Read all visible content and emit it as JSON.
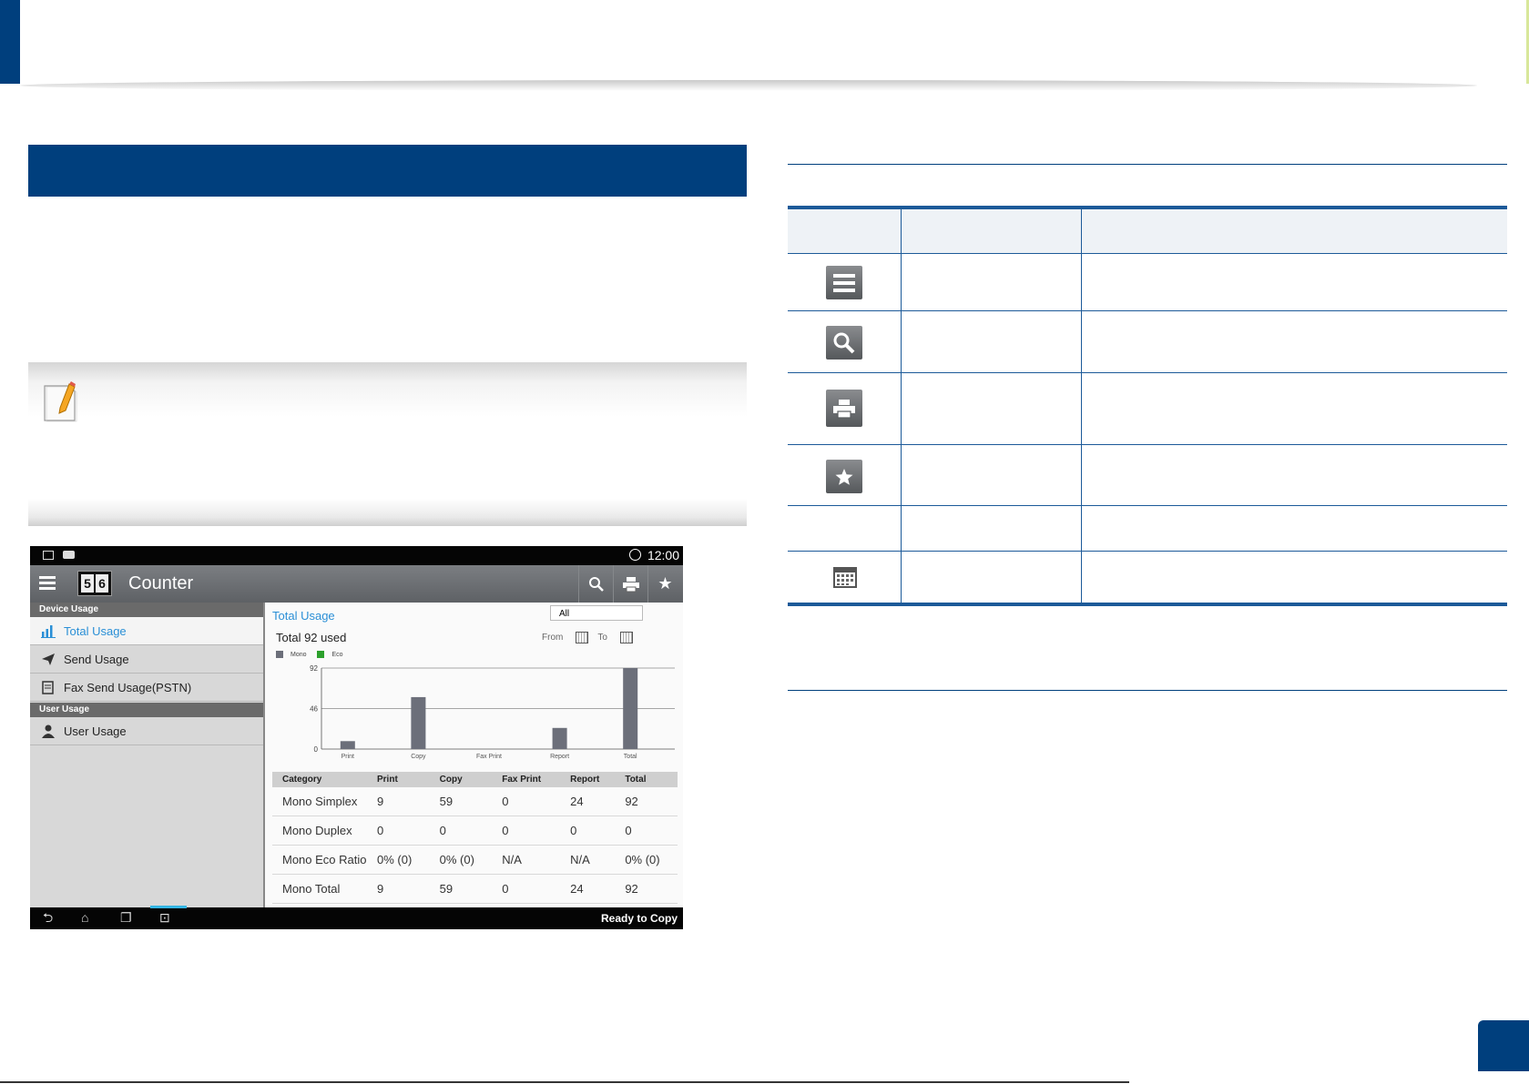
{
  "device": {
    "status_time": "12:00",
    "app_title": "Counter",
    "logo_digits": [
      "5",
      "6"
    ],
    "sidebar": {
      "section1": "Device Usage",
      "items1": [
        "Total Usage",
        "Send Usage",
        "Fax Send Usage(PSTN)"
      ],
      "section2": "User Usage",
      "items2": [
        "User Usage"
      ]
    },
    "content": {
      "heading": "Total Usage",
      "filter_value": "All",
      "total_text": "Total 92 used",
      "from_label": "From",
      "to_label": "To",
      "legend_mono": "Mono",
      "legend_eco": "Eco"
    },
    "table": {
      "headers": [
        "Category",
        "Print",
        "Copy",
        "Fax Print",
        "Report",
        "Total"
      ],
      "rows": [
        [
          "Mono Simplex",
          "9",
          "59",
          "0",
          "24",
          "92"
        ],
        [
          "Mono Duplex",
          "0",
          "0",
          "0",
          "0",
          "0"
        ],
        [
          "Mono Eco Ratio",
          "0% (0)",
          "0% (0)",
          "N/A",
          "N/A",
          "0% (0)"
        ],
        [
          "Mono Total",
          "9",
          "59",
          "0",
          "24",
          "92"
        ]
      ]
    },
    "status_message": "Ready to Copy"
  },
  "chart_data": {
    "type": "bar",
    "categories": [
      "Print",
      "Copy",
      "Fax Print",
      "Report",
      "Total"
    ],
    "series": [
      {
        "name": "Mono",
        "values": [
          9,
          59,
          0,
          24,
          92
        ]
      },
      {
        "name": "Eco",
        "values": [
          0,
          0,
          0,
          0,
          0
        ]
      }
    ],
    "yticks": [
      0,
      46,
      92
    ],
    "ylim": [
      0,
      92
    ],
    "grid": true,
    "legend": "top-left"
  },
  "colors": {
    "brand_blue": "#003f7d",
    "mono_bar": "#6c6f7a",
    "eco_legend": "#2ca02c",
    "accent_text": "#2a8fd6"
  },
  "reference_icons": [
    "menu-icon",
    "search-icon",
    "printer-icon",
    "star-icon",
    "",
    "calendar-icon"
  ]
}
